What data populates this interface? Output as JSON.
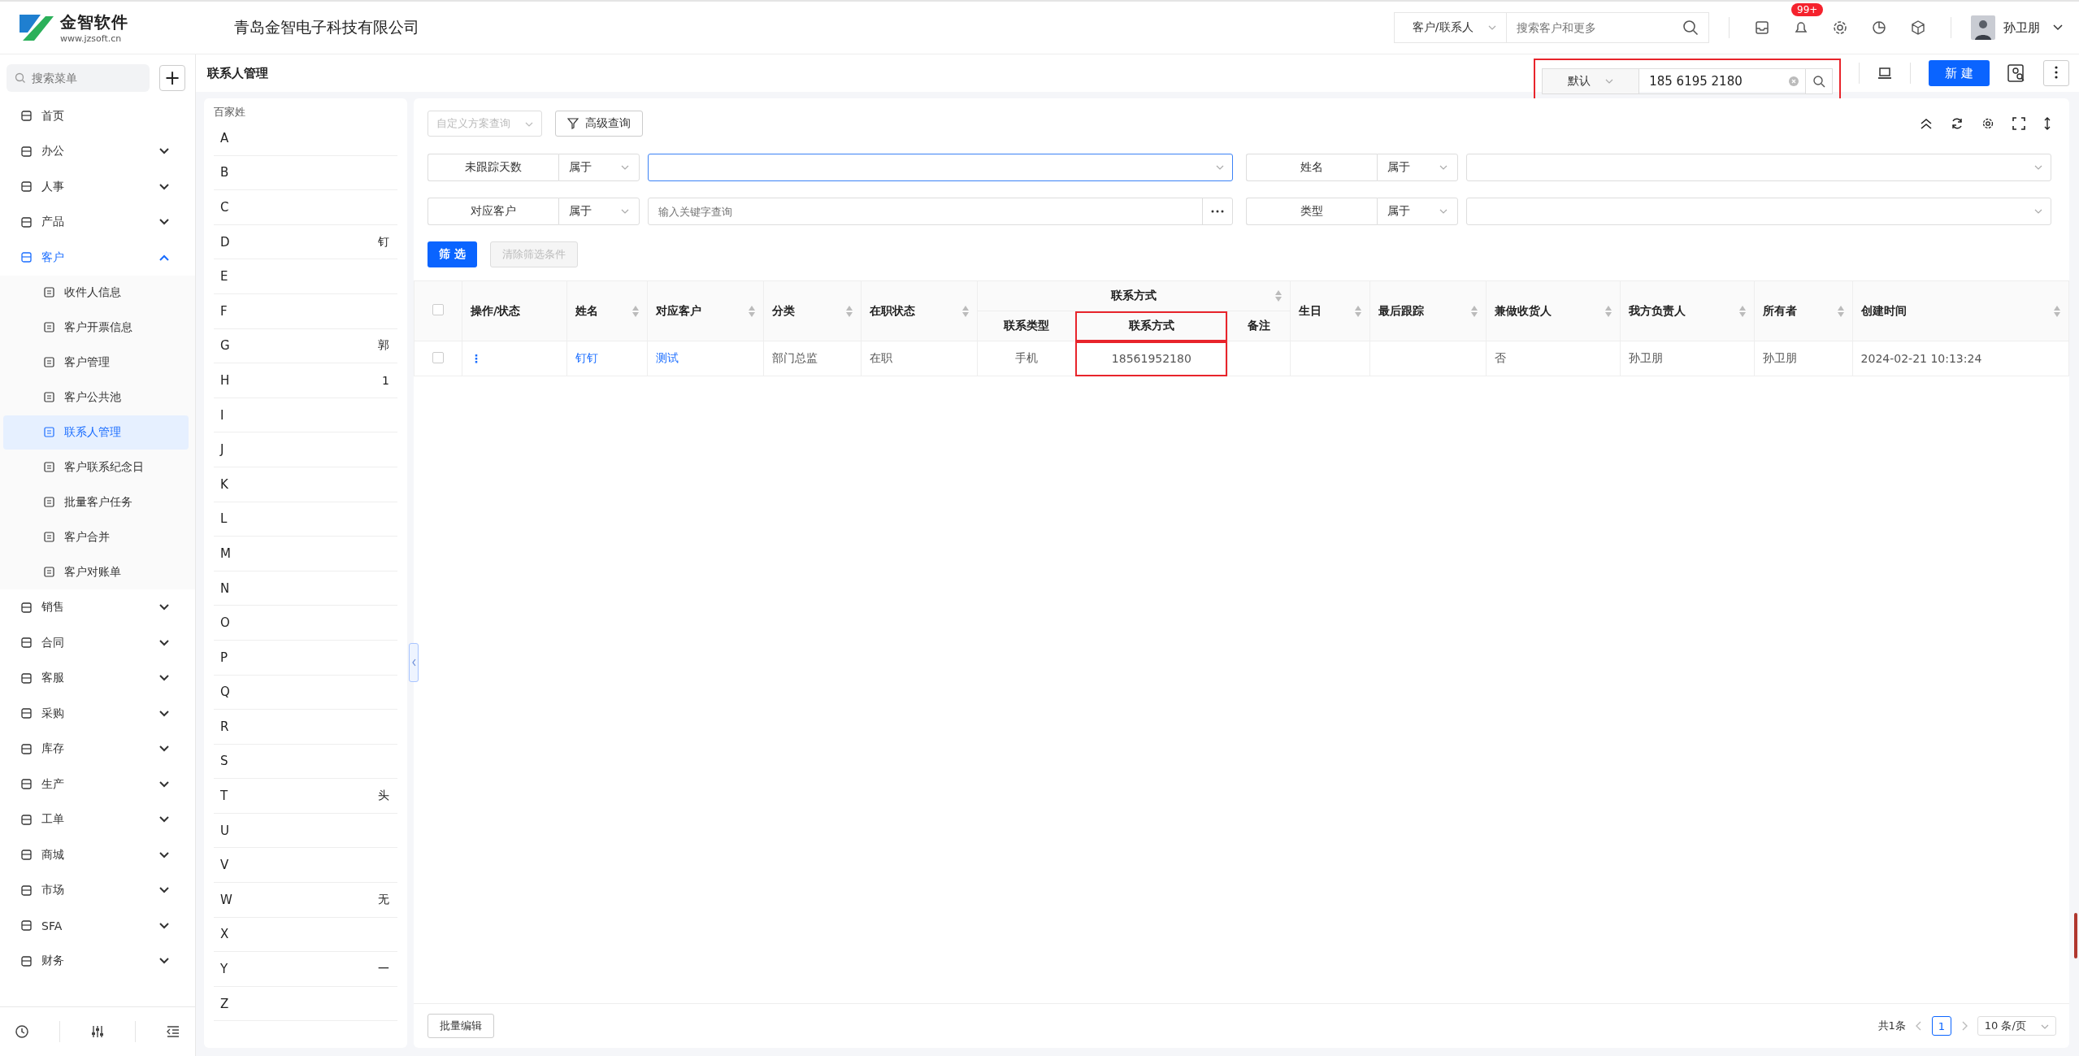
{
  "header": {
    "logo_name": "金智软件",
    "logo_url": "www.jzsoft.cn",
    "company": "青岛金智电子科技有限公司",
    "search_scope": "客户/联系人",
    "search_placeholder": "搜索客户和更多",
    "notification_badge": "99+",
    "user": "孙卫朋"
  },
  "sidebar": {
    "search_placeholder": "搜索菜单",
    "add": "+",
    "items": [
      {
        "label": "首页",
        "kind": "link",
        "selected": false
      },
      {
        "label": "办公",
        "kind": "group",
        "expanded": false,
        "selected": false
      },
      {
        "label": "人事",
        "kind": "group",
        "expanded": false,
        "selected": false
      },
      {
        "label": "产品",
        "kind": "group",
        "expanded": false,
        "selected": false
      },
      {
        "label": "客户",
        "kind": "group",
        "expanded": true,
        "selected": true,
        "children": [
          {
            "label": "收件人信息",
            "selected": false
          },
          {
            "label": "客户开票信息",
            "selected": false
          },
          {
            "label": "客户管理",
            "selected": false
          },
          {
            "label": "客户公共池",
            "selected": false
          },
          {
            "label": "联系人管理",
            "selected": true
          },
          {
            "label": "客户联系纪念日",
            "selected": false
          },
          {
            "label": "批量客户任务",
            "selected": false
          },
          {
            "label": "客户合并",
            "selected": false
          },
          {
            "label": "客户对账单",
            "selected": false
          }
        ]
      },
      {
        "label": "销售",
        "kind": "group",
        "expanded": false,
        "selected": false
      },
      {
        "label": "合同",
        "kind": "group",
        "expanded": false,
        "selected": false
      },
      {
        "label": "客服",
        "kind": "group",
        "expanded": false,
        "selected": false
      },
      {
        "label": "采购",
        "kind": "group",
        "expanded": false,
        "selected": false
      },
      {
        "label": "库存",
        "kind": "group",
        "expanded": false,
        "selected": false
      },
      {
        "label": "生产",
        "kind": "group",
        "expanded": false,
        "selected": false
      },
      {
        "label": "工单",
        "kind": "group",
        "expanded": false,
        "selected": false
      },
      {
        "label": "商城",
        "kind": "group",
        "expanded": false,
        "selected": false
      },
      {
        "label": "市场",
        "kind": "group",
        "expanded": false,
        "selected": false
      },
      {
        "label": "SFA",
        "kind": "group",
        "expanded": false,
        "selected": false
      },
      {
        "label": "财务",
        "kind": "group",
        "expanded": false,
        "selected": false
      }
    ]
  },
  "page": {
    "title": "联系人管理",
    "search_mode": "默认",
    "search_value": "185 6195 2180",
    "search_highlighted": true,
    "new_button": "新 建"
  },
  "surnames": {
    "title": "百家姓",
    "letters": [
      {
        "letter": "A"
      },
      {
        "letter": "B"
      },
      {
        "letter": "C"
      },
      {
        "letter": "D",
        "name": "钉"
      },
      {
        "letter": "E"
      },
      {
        "letter": "F"
      },
      {
        "letter": "G",
        "name": "郭"
      },
      {
        "letter": "H",
        "name": "1"
      },
      {
        "letter": "I"
      },
      {
        "letter": "J"
      },
      {
        "letter": "K"
      },
      {
        "letter": "L"
      },
      {
        "letter": "M"
      },
      {
        "letter": "N"
      },
      {
        "letter": "O"
      },
      {
        "letter": "P"
      },
      {
        "letter": "Q"
      },
      {
        "letter": "R"
      },
      {
        "letter": "S"
      },
      {
        "letter": "T",
        "name": "头"
      },
      {
        "letter": "U"
      },
      {
        "letter": "V"
      },
      {
        "letter": "W",
        "name": "无"
      },
      {
        "letter": "X"
      },
      {
        "letter": "Y",
        "name": "一"
      },
      {
        "letter": "Z"
      }
    ]
  },
  "filters": {
    "scheme_placeholder": "自定义方案查询",
    "advanced": "高级查询",
    "rows": [
      [
        {
          "field": "未跟踪天数",
          "operator": "属于",
          "kind": "select",
          "focused": true
        },
        {
          "field": "姓名",
          "operator": "属于",
          "kind": "select",
          "focused": false
        }
      ],
      [
        {
          "field": "对应客户",
          "operator": "属于",
          "kind": "lookup",
          "placeholder": "输入关键字查询",
          "focused": false
        },
        {
          "field": "类型",
          "operator": "属于",
          "kind": "select",
          "focused": false
        }
      ]
    ],
    "apply": "筛 选",
    "clear": "清除筛选条件",
    "clear_disabled": true
  },
  "table": {
    "columns": [
      {
        "label": "操作/状态",
        "sortable": false
      },
      {
        "label": "姓名",
        "sortable": true
      },
      {
        "label": "对应客户",
        "sortable": true
      },
      {
        "label": "分类",
        "sortable": true
      },
      {
        "label": "在职状态",
        "sortable": true
      },
      {
        "label": "联系方式",
        "sortable": true,
        "colspan": 3,
        "children": [
          {
            "label": "联系类型"
          },
          {
            "label": "联系方式",
            "highlighted": true
          },
          {
            "label": "备注"
          }
        ]
      },
      {
        "label": "生日",
        "sortable": true
      },
      {
        "label": "最后跟踪",
        "sortable": true
      },
      {
        "label": "兼做收货人",
        "sortable": true
      },
      {
        "label": "我方负责人",
        "sortable": true
      },
      {
        "label": "所有者",
        "sortable": true
      },
      {
        "label": "创建时间",
        "sortable": true
      }
    ],
    "all_checked": false,
    "rows": [
      {
        "checked": false,
        "cells": [
          {
            "text": "⋮",
            "kind": "action"
          },
          {
            "text": "钉钉",
            "kind": "link"
          },
          {
            "text": "测试",
            "kind": "link"
          },
          {
            "text": "部门总监",
            "kind": "text"
          },
          {
            "text": "在职",
            "kind": "text"
          },
          {
            "text": "手机",
            "kind": "center"
          },
          {
            "text": "18561952180",
            "kind": "center",
            "highlighted": true
          },
          {
            "kind": "text"
          },
          {
            "kind": "text"
          },
          {
            "kind": "text"
          },
          {
            "text": "否",
            "kind": "text"
          },
          {
            "text": "孙卫朋",
            "kind": "text"
          },
          {
            "text": "孙卫朋",
            "kind": "text"
          },
          {
            "text": "2024-02-21 10:13:24",
            "kind": "text"
          }
        ]
      }
    ]
  },
  "footer": {
    "batch_edit": "批量编辑",
    "total": "共1条",
    "pages": [
      {
        "label": "1",
        "selected": true
      }
    ],
    "page_size": "10 条/页"
  }
}
